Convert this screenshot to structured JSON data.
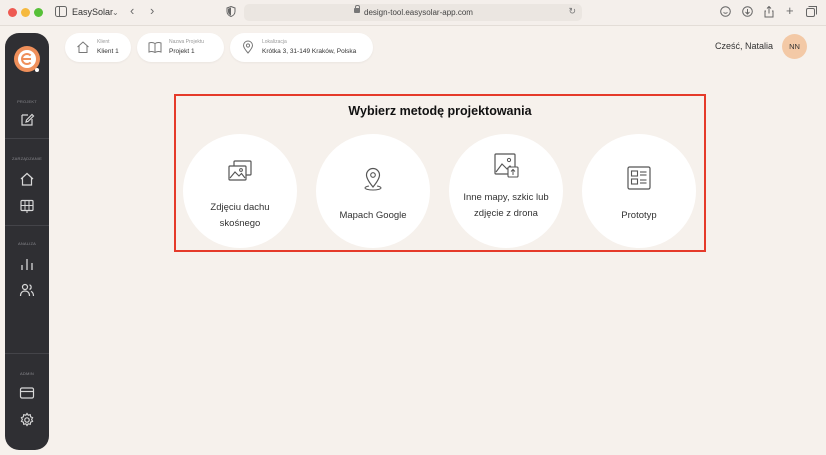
{
  "browser": {
    "app_name": "EasySolar",
    "url": "design-tool.easysolar-app.com"
  },
  "sidebar": {
    "sections": [
      {
        "label": "PROJEKT"
      },
      {
        "label": "ZARZĄDZANIE"
      },
      {
        "label": "ANALIZA"
      },
      {
        "label": "ADMIN"
      }
    ],
    "items": [
      {
        "icon": "edit-icon"
      },
      {
        "icon": "home-icon"
      },
      {
        "icon": "solar-panel-icon"
      },
      {
        "icon": "bar-chart-icon"
      },
      {
        "icon": "users-icon"
      },
      {
        "icon": "credit-card-icon"
      },
      {
        "icon": "gear-icon"
      }
    ]
  },
  "header": {
    "client": {
      "label": "Klient",
      "value": "Klient 1",
      "icon": "home-icon"
    },
    "project": {
      "label": "Nazwa Projektu",
      "value": "Projekt 1",
      "icon": "book-icon"
    },
    "location": {
      "label": "Lokalizacja",
      "value": "Krótka 3, 31-149 Kraków, Polska",
      "icon": "location-pin-icon"
    },
    "greeting": "Cześć, Natalia",
    "avatar_initials": "NN"
  },
  "methods": {
    "title": "Wybierz metodę projektowania",
    "options": [
      {
        "label": "Zdjęciu dachu skośnego",
        "icon": "images-icon"
      },
      {
        "label": "Mapach Google",
        "icon": "map-pin-icon"
      },
      {
        "label": "Inne mapy, szkic lub zdjęcie z drona",
        "icon": "image-upload-icon"
      },
      {
        "label": "Prototyp",
        "icon": "layout-icon"
      }
    ]
  },
  "colors": {
    "background": "#f6f1ec",
    "sidebar": "#2f2f33",
    "accent": "#ef8f5a",
    "highlight_border": "#e53a2a",
    "avatar": "#f3c9a6"
  }
}
